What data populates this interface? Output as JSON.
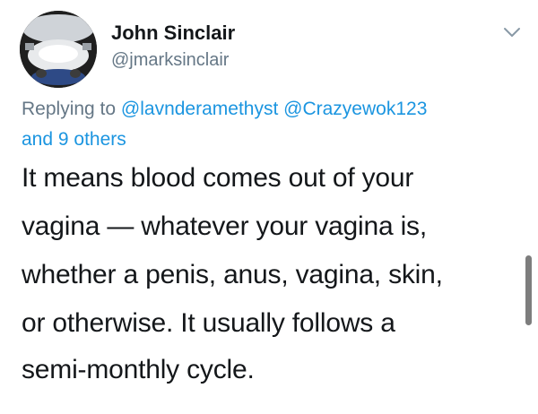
{
  "author": {
    "name": "John Sinclair",
    "handle": "@jmarksinclair"
  },
  "reply": {
    "prefix": "Replying to",
    "mentions": [
      "@lavnderamethyst",
      "@Crazyewok123"
    ],
    "others": "and 9 others"
  },
  "tweet": {
    "lines": [
      "It means blood comes out of your",
      "vagina — whatever your vagina is,",
      "whether a penis, anus, vagina, skin,",
      "or otherwise. It usually follows a",
      "semi-monthly cycle."
    ]
  },
  "icons": {
    "avatar": "profile-photo",
    "menu": "chevron-down-icon"
  },
  "colors": {
    "mention": "#1b95e0",
    "secondary_text": "#657786",
    "primary_text": "#14171a"
  }
}
